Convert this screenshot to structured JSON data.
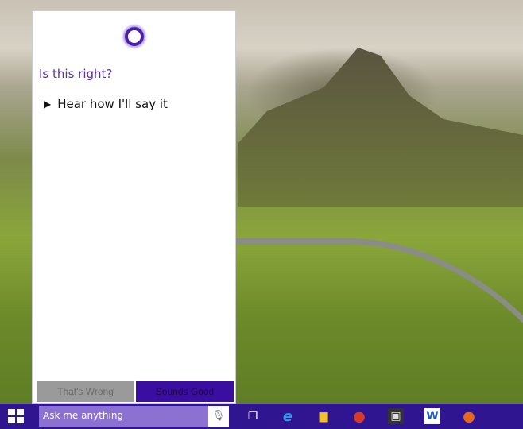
{
  "cortana": {
    "question": "Is this right?",
    "hear_label": "Hear how I'll say it",
    "play_icon": "▶",
    "wrong_label": "That's Wrong",
    "good_label": "Sounds Good"
  },
  "taskbar": {
    "search_placeholder": "Ask me anything",
    "mic_icon": "🎙",
    "apps": [
      {
        "name": "task-view",
        "glyph": "❐"
      },
      {
        "name": "internet-explorer",
        "glyph": "e"
      },
      {
        "name": "file-explorer",
        "glyph": "▆"
      },
      {
        "name": "chrome",
        "glyph": "●"
      },
      {
        "name": "store",
        "glyph": "▣"
      },
      {
        "name": "word",
        "glyph": "W"
      },
      {
        "name": "firefox",
        "glyph": "●"
      }
    ]
  },
  "colors": {
    "accent": "#2f1690",
    "search": "#8c70d2",
    "question": "#5a2eb8"
  }
}
